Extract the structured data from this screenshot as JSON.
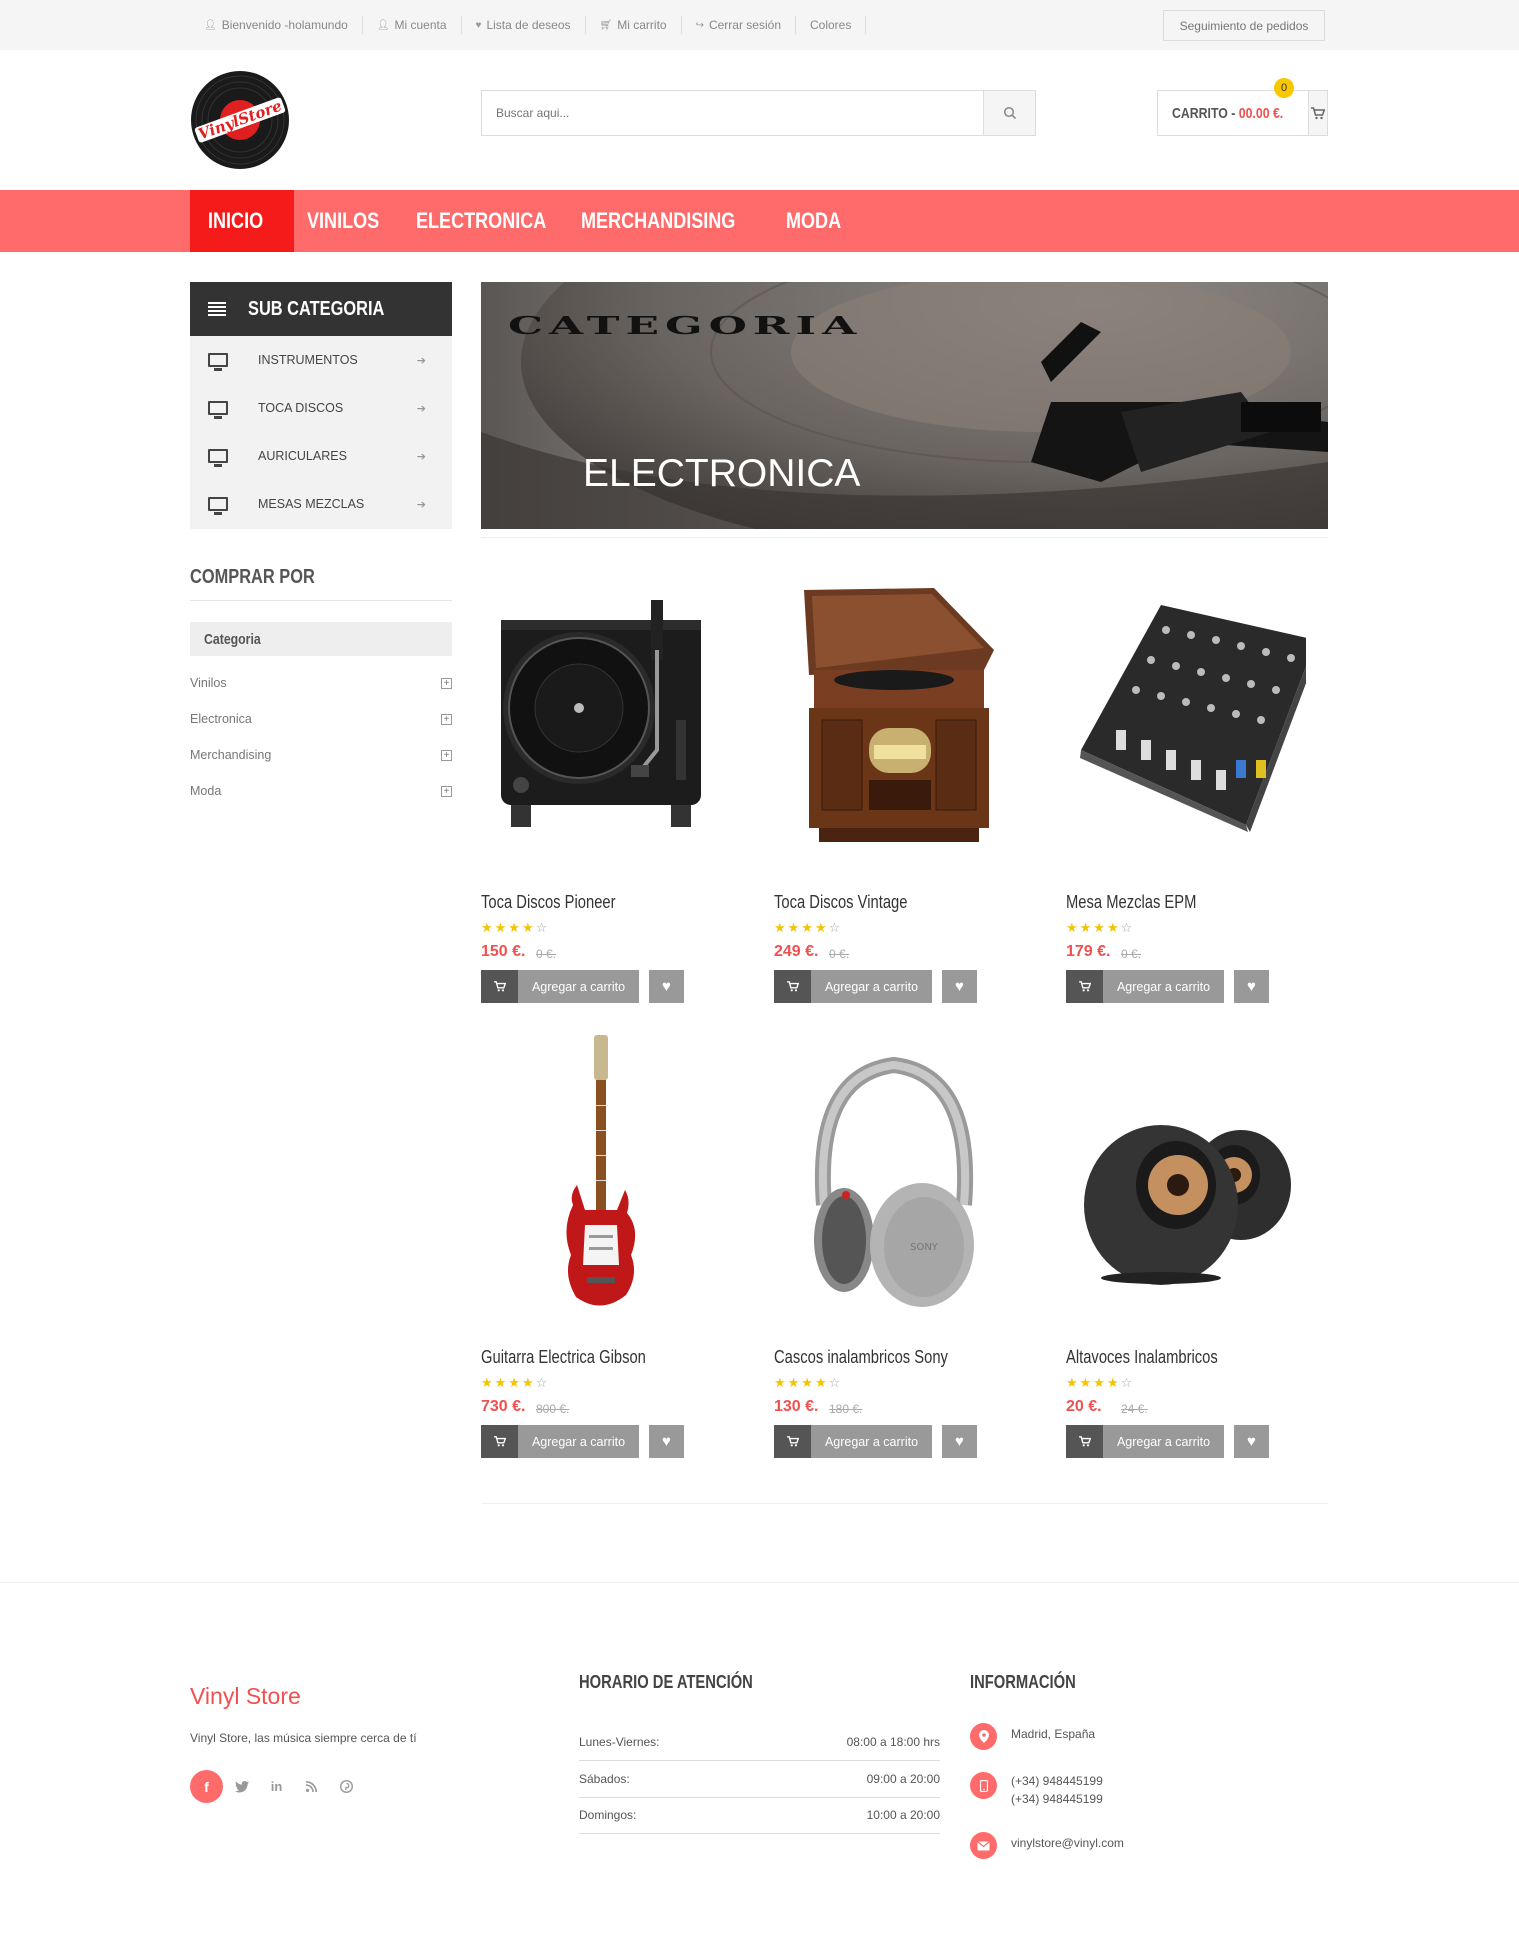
{
  "topbar": {
    "links": [
      {
        "label": "Bienvenido -holamundo",
        "icon": "user-icon"
      },
      {
        "label": "Mi cuenta",
        "icon": "user-icon"
      },
      {
        "label": "Lista de deseos",
        "icon": "heart-icon"
      },
      {
        "label": "Mi carrito",
        "icon": "cart-icon"
      },
      {
        "label": "Cerrar sesión",
        "icon": "logout-icon"
      },
      {
        "label": "Colores",
        "icon": ""
      }
    ],
    "track_orders": "Seguimiento de pedidos"
  },
  "header": {
    "logo_text": "VinylStore",
    "search_placeholder": "Buscar aqui...",
    "cart_label": "CARRITO -",
    "cart_amount": "00.00 €.",
    "cart_count": "0"
  },
  "nav": [
    "INICIO",
    "VINILOS",
    "ELECTRONICA",
    "MERCHANDISING",
    "MODA"
  ],
  "sidebar": {
    "subcat_title": "SUB CATEGORIA",
    "subcats": [
      "INSTRUMENTOS",
      "TOCA DISCOS",
      "AURICULARES",
      "MESAS MEZCLAS"
    ],
    "shop_by": "COMPRAR POR",
    "category_head": "Categoria",
    "categories": [
      "Vinilos",
      "Electronica",
      "Merchandising",
      "Moda"
    ]
  },
  "banner": {
    "title": "CATEGORIA",
    "subtitle": "ELECTRONICA"
  },
  "products": [
    {
      "name": "Toca Discos Pioneer",
      "price": "150 €.",
      "old_price": "0 €.",
      "rating": 4
    },
    {
      "name": "Toca Discos Vintage",
      "price": "249 €.",
      "old_price": "0 €.",
      "rating": 4
    },
    {
      "name": "Mesa Mezclas EPM",
      "price": "179 €.",
      "old_price": "0 €.",
      "rating": 4
    },
    {
      "name": "Guitarra Electrica Gibson",
      "price": "730 €.",
      "old_price": "800 €.",
      "rating": 4
    },
    {
      "name": "Cascos inalambricos Sony",
      "price": "130 €.",
      "old_price": "180 €.",
      "rating": 4
    },
    {
      "name": "Altavoces Inalambricos",
      "price": "20 €.",
      "old_price": "24 €.",
      "rating": 4
    }
  ],
  "add_to_cart_label": "Agregar a carrito",
  "footer": {
    "brand": "Vinyl Store",
    "tagline": "Vinyl Store, las música siempre cerca de tí",
    "hours_title": "HORARIO DE ATENCIÓN",
    "hours": [
      {
        "day": "Lunes-Viernes:",
        "time": "08:00 a 18:00 hrs"
      },
      {
        "day": "Sábados:",
        "time": "09:00 a 20:00"
      },
      {
        "day": "Domingos:",
        "time": "10:00 a 20:00"
      }
    ],
    "info_title": "INFORMACIÓN",
    "address": "Madrid, España",
    "phone1": "(+34) 948445199",
    "phone2": "(+34) 948445199",
    "email": "vinylstore@vinyl.com"
  },
  "colors": {
    "accent": "#ff6b6b",
    "nav_active": "#f51b1b",
    "price": "#f15050",
    "badge": "#f7c800"
  }
}
